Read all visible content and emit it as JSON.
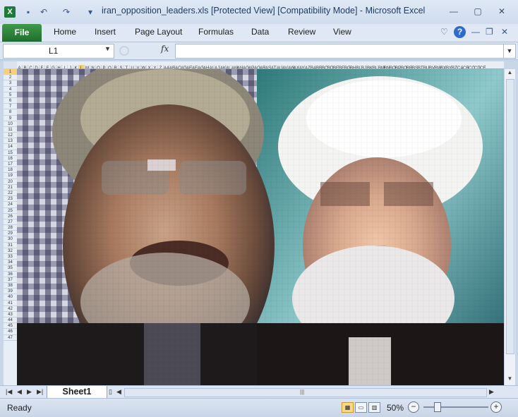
{
  "window": {
    "title": "iran_opposition_leaders.xls  [Protected View]  [Compatibility Mode]  -  Microsoft Excel",
    "minimize_icon": "minimize-icon",
    "maximize_icon": "maximize-icon",
    "close_icon": "close-icon"
  },
  "qat": {
    "logo_icon": "excel-logo-icon",
    "save_icon": "save-icon",
    "undo_icon": "undo-icon",
    "redo_icon": "redo-icon",
    "customize_icon": "customize-qat-icon"
  },
  "ribbon": {
    "tabs": [
      "File",
      "Home",
      "Insert",
      "Page Layout",
      "Formulas",
      "Data",
      "Review",
      "View"
    ],
    "right_icons": [
      "minimize-ribbon-icon",
      "help-icon",
      "window-minimize-icon",
      "window-restore-icon",
      "window-close-icon"
    ]
  },
  "formula_bar": {
    "name_box": "L1",
    "fx_label": "fx",
    "formula_value": ""
  },
  "grid": {
    "column_headers": [
      "A",
      "B",
      "C",
      "D",
      "E",
      "F",
      "G",
      "H",
      "I",
      "J",
      "K",
      "L",
      "M",
      "N",
      "O",
      "P",
      "Q",
      "R",
      "S",
      "T",
      "U",
      "V",
      "W",
      "X",
      "Y",
      "Z",
      "AA",
      "AB",
      "AC",
      "AD",
      "AE",
      "AF",
      "AG",
      "AH",
      "AI",
      "AJ",
      "AK",
      "AL",
      "AM",
      "AN",
      "AO",
      "AP",
      "AQ",
      "AR",
      "AS",
      "AT",
      "AU",
      "AV",
      "AW",
      "AX",
      "AY",
      "AZ",
      "BA",
      "BB",
      "BC",
      "BD",
      "BE",
      "BF",
      "BG",
      "BH",
      "BI",
      "BJ",
      "BK",
      "BL",
      "BM",
      "BN",
      "BO",
      "BP",
      "BQ",
      "BR",
      "BS",
      "BT",
      "BU",
      "BV",
      "BW",
      "BX",
      "BY",
      "BZ",
      "CA",
      "CB",
      "CC",
      "CD",
      "CE"
    ],
    "row_headers": [
      "1",
      "2",
      "3",
      "4",
      "5",
      "6",
      "7",
      "8",
      "9",
      "10",
      "11",
      "12",
      "13",
      "14",
      "15",
      "16",
      "17",
      "18",
      "19",
      "20",
      "21",
      "22",
      "23",
      "24",
      "25",
      "26",
      "27",
      "28",
      "29",
      "30",
      "31",
      "32",
      "33",
      "34",
      "35",
      "36",
      "37",
      "38",
      "39",
      "40",
      "41",
      "42",
      "43",
      "44",
      "45",
      "46",
      "47"
    ],
    "selected_column": "L",
    "selected_row": "1"
  },
  "sheets": {
    "tabs": [
      "Sheet1"
    ],
    "nav_icons": [
      "first-sheet-icon",
      "prev-sheet-icon",
      "next-sheet-icon",
      "last-sheet-icon"
    ]
  },
  "status": {
    "text": "Ready",
    "zoom_text": "50%",
    "view_icons": [
      "normal-view-icon",
      "page-layout-view-icon",
      "page-break-view-icon"
    ]
  }
}
